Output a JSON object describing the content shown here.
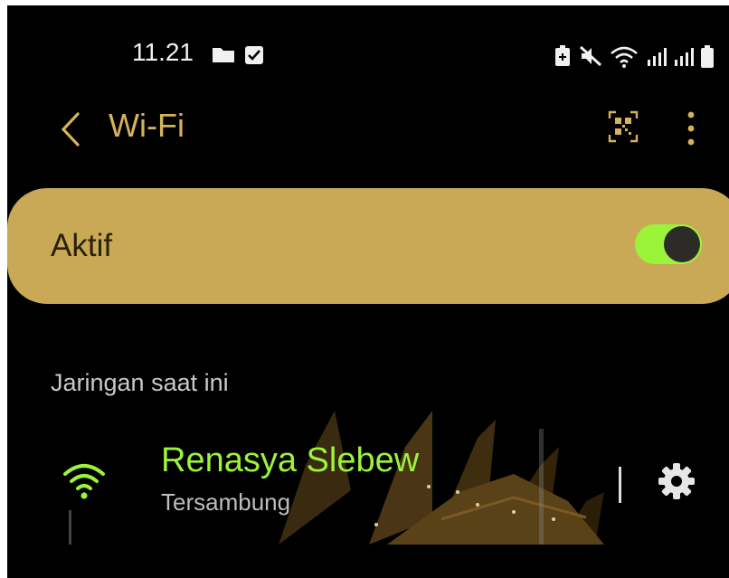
{
  "status_bar": {
    "time": "11.21",
    "left_icons": [
      "folder-icon",
      "checkbox-icon"
    ],
    "right_icons": [
      "battery-saver-icon",
      "mute-icon",
      "wifi-status-icon",
      "signal-icon",
      "signal-icon",
      "battery-icon"
    ]
  },
  "app_bar": {
    "title": "Wi-Fi",
    "back_icon": "chevron-left-icon",
    "actions": [
      "qr-code-icon",
      "more-vert-icon"
    ]
  },
  "toggle": {
    "label": "Aktif",
    "state": "on"
  },
  "current_network_section": {
    "label": "Jaringan saat ini"
  },
  "current_network": {
    "name": "Renasya Slebew",
    "status": "Tersambung",
    "icon": "wifi-icon",
    "settings_icon": "gear-icon"
  },
  "colors": {
    "background": "#000000",
    "accent": "#d6b25a",
    "card": "#c9a955",
    "connected": "#9bf33a"
  }
}
